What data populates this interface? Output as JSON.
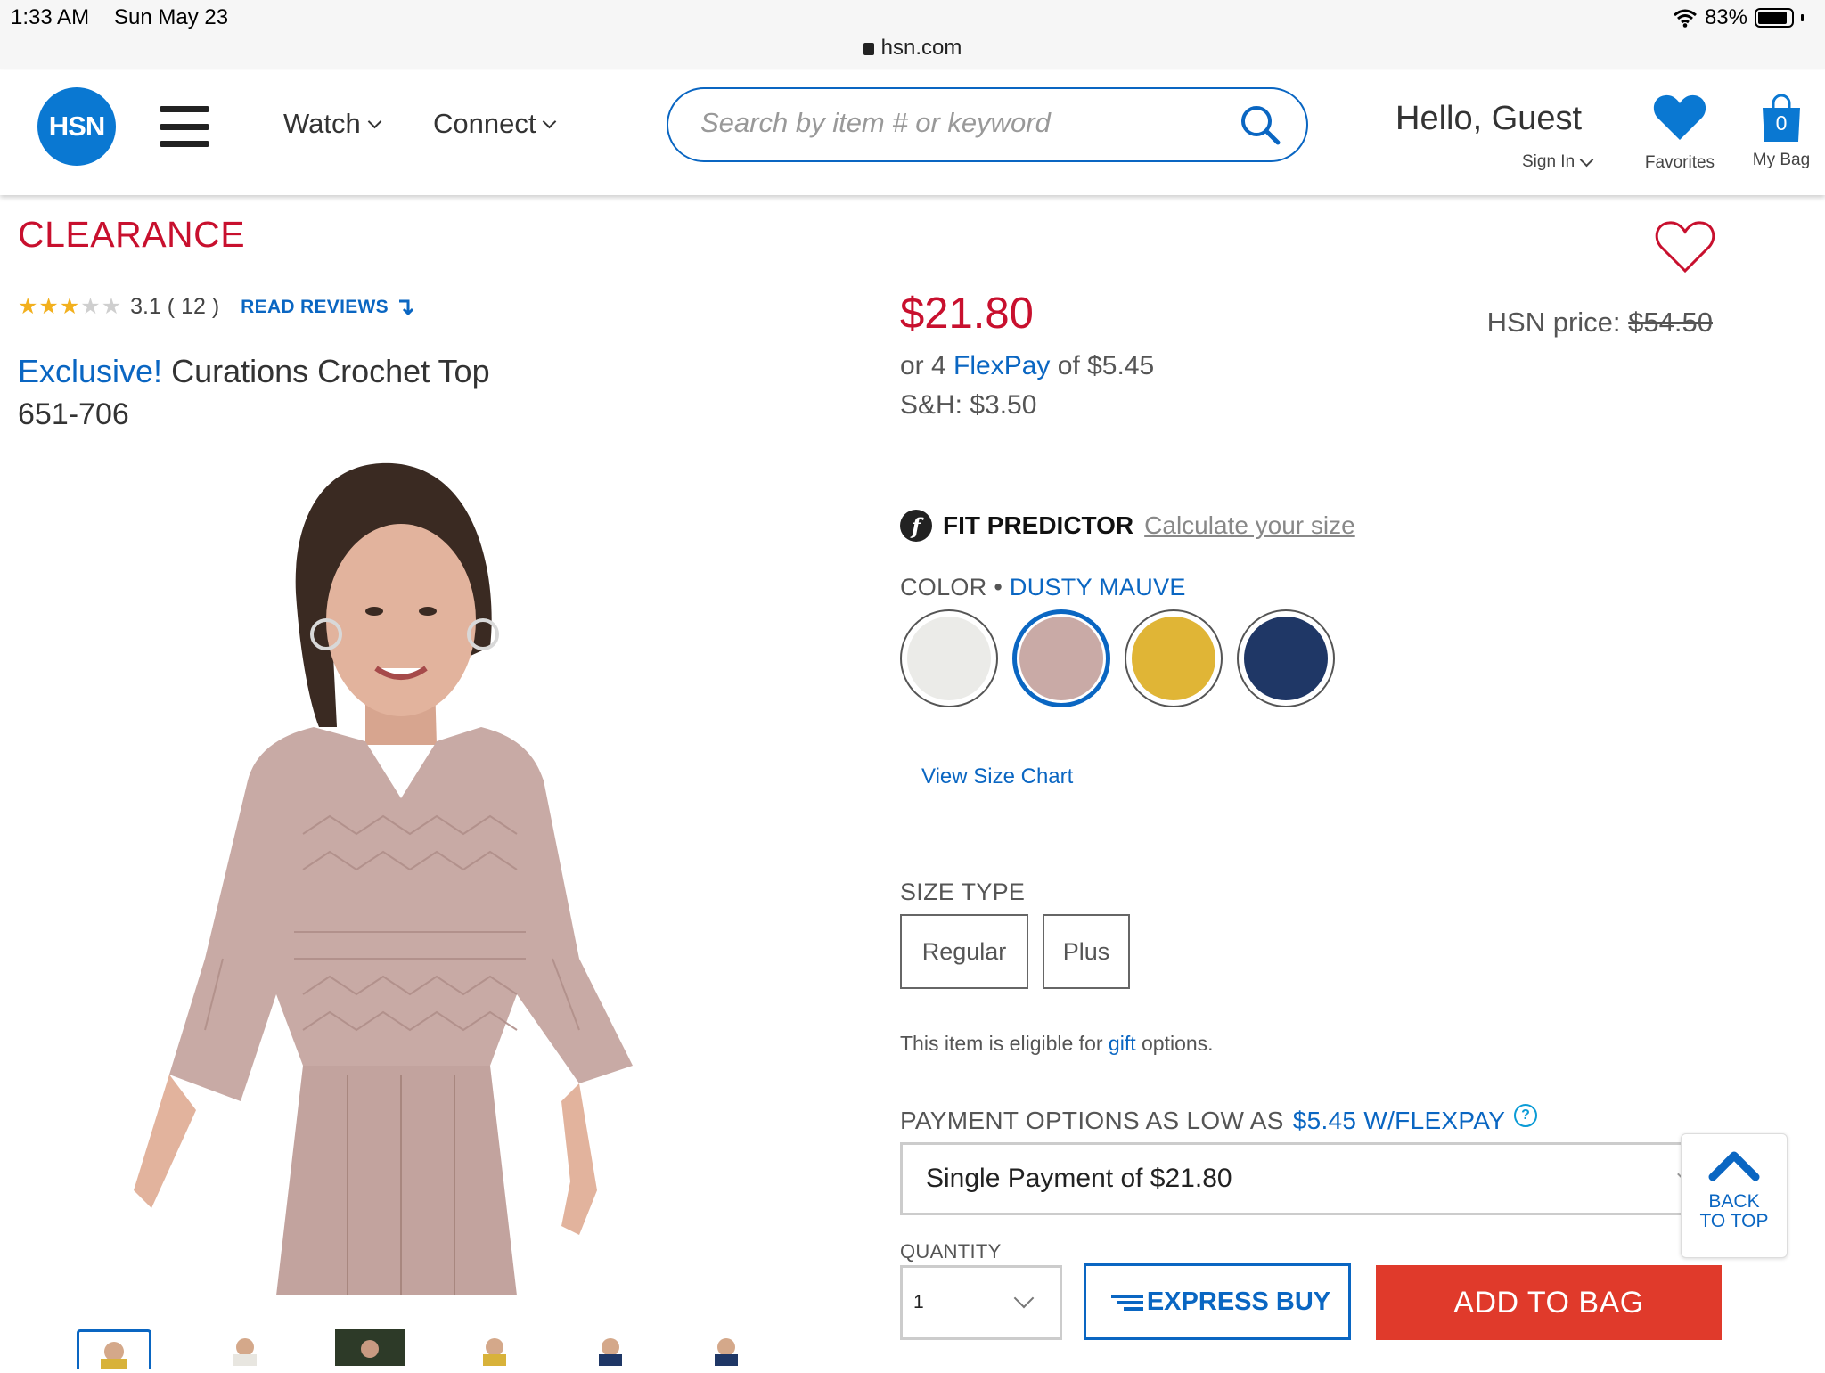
{
  "status_bar": {
    "time": "1:33 AM",
    "date": "Sun May 23",
    "battery": "83%",
    "url": "hsn.com"
  },
  "header": {
    "logo": "HSN",
    "nav": [
      {
        "label": "Watch"
      },
      {
        "label": "Connect"
      }
    ],
    "search_placeholder": "Search by item # or keyword",
    "greeting": "Hello, Guest",
    "sign_in": "Sign In",
    "favorites_label": "Favorites",
    "bag_label": "My Bag",
    "bag_count": "0"
  },
  "product": {
    "badge": "CLEARANCE",
    "rating_value": 3.1,
    "rating_text": "3.1 ( 12 )",
    "read_reviews": "READ REVIEWS",
    "exclusive": "Exclusive!",
    "name": "Curations Crochet Top",
    "item_number": "651-706",
    "price": "$21.80",
    "hsn_price_label": "HSN price:",
    "hsn_price": "$54.50",
    "flexpay_prefix": "or 4",
    "flexpay_link": "FlexPay",
    "flexpay_suffix": "of $5.45",
    "shipping": "S&H: $3.50"
  },
  "fit_predictor": {
    "icon_letter": "f",
    "label": "FIT PREDICTOR",
    "link": "Calculate your size"
  },
  "color": {
    "label": "COLOR •",
    "selected": "DUSTY MAUVE",
    "swatches": [
      {
        "name": "white",
        "color": "#ebebe8"
      },
      {
        "name": "dusty-mauve",
        "color": "#c9aaa6"
      },
      {
        "name": "yellow",
        "color": "#e0b536"
      },
      {
        "name": "navy",
        "color": "#1f3766"
      }
    ]
  },
  "size_chart_link": "View Size Chart",
  "size_type": {
    "label": "SIZE TYPE",
    "options": [
      "Regular",
      "Plus"
    ]
  },
  "gift": {
    "prefix": "This item is eligible for",
    "link": "gift",
    "suffix": "options."
  },
  "payment": {
    "label_prefix": "PAYMENT OPTIONS AS LOW AS",
    "label_highlight": "$5.45 W/FLEXPAY",
    "help": "?",
    "selected": "Single Payment of $21.80"
  },
  "back_to_top": {
    "line1": "BACK",
    "line2": "TO TOP"
  },
  "quantity": {
    "label": "QUANTITY",
    "value": "1"
  },
  "buttons": {
    "express_buy": "EXPRESS BUY",
    "add_to_bag": "ADD TO BAG"
  },
  "colors": {
    "brand_blue": "#0a66c2",
    "sale_red": "#c8102e",
    "add_to_bag": "#e03a2b",
    "logo_blue": "#0a78d2"
  }
}
